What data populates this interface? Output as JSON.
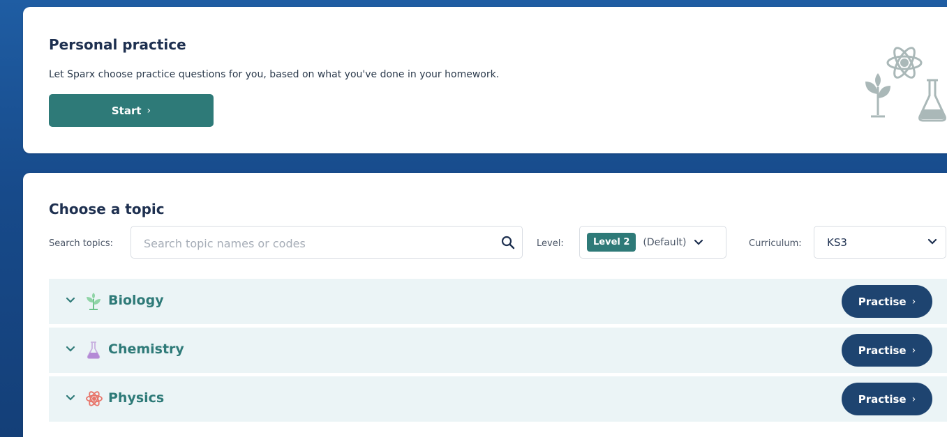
{
  "personal_practice": {
    "title": "Personal practice",
    "description": "Let Sparx choose practice questions for you, based on what you've done in your homework.",
    "start_label": "Start",
    "chevron": "›"
  },
  "topics": {
    "title": "Choose a topic",
    "search_label": "Search topics:",
    "search_placeholder": "Search topic names or codes",
    "search_value": "",
    "level_label": "Level:",
    "level_value": "Level 2",
    "level_default": "(Default)",
    "curriculum_label": "Curriculum:",
    "curriculum_value": "KS3",
    "practise_label": "Practise",
    "items": [
      {
        "name": "Biology",
        "icon": "plant-icon",
        "icon_color": "#6ac28a"
      },
      {
        "name": "Chemistry",
        "icon": "flask-icon",
        "icon_color": "#b48ad6"
      },
      {
        "name": "Physics",
        "icon": "atom-icon",
        "icon_color": "#e8756a"
      }
    ]
  },
  "colors": {
    "accent": "#2e7a78",
    "practise_button": "#1e4470",
    "row_background": "#ebf4f6",
    "heading": "#1e3050"
  }
}
